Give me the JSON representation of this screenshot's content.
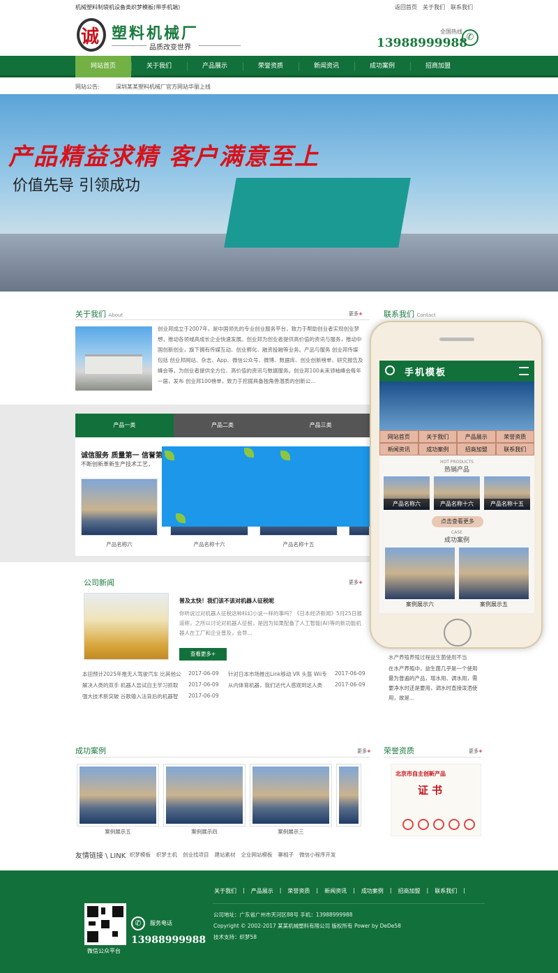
{
  "topbar": {
    "site_desc": "机械塑料制袋机设备类织梦模板(带手机端)",
    "links": [
      "返回首页",
      "关于我们",
      "联系我们"
    ]
  },
  "header": {
    "logo_char": "诚",
    "logo_title": "塑料机械厂",
    "logo_slogan": "品质改变世界",
    "hotline_label": "全国热线",
    "hotline": "13988999988"
  },
  "nav": {
    "items": [
      "网站首页",
      "关于我们",
      "产品展示",
      "荣誉资质",
      "新闻资讯",
      "成功案例",
      "招商加盟"
    ]
  },
  "notice": {
    "label": "网站公告:",
    "text": "深圳某某塑料机械厂官方网站华丽上线"
  },
  "banner": {
    "headline": "产品精益求精  客户满意至上",
    "subline": "价值先导 引领成功"
  },
  "about": {
    "title": "关于我们",
    "title_en": "About",
    "more": "更多",
    "text": "创业邦成立于2007年，是中国领先的专业创业服务平台，致力于帮助创业者实现创业梦想，推动各领域高成长企业快速发展。创业邦为创业者提供高价值的资讯与服务，推动中国创新创业，旗下拥有传媒互动、创业孵化、融资投融等业务。产品与服务 创业邦传媒 包括 创业邦网站、杂志、App、微信公众号、微博、数据库、创业创新榜单、研究报告及峰会等，为创业者提供全方位、高价值的资讯与数据服务。创业邦100未来领袖峰会每年一届，发布 创业邦100榜单，致力于挖掘具备独角兽潜质的创新公..."
  },
  "contact": {
    "title": "联系我们",
    "title_en": "Contact"
  },
  "products": {
    "tabs": [
      "产品一类",
      "产品二类",
      "产品三类"
    ],
    "slogan": "诚信服务 质量第一 信誉第",
    "slogan2": "不断创新革新生产技术工艺，",
    "items": [
      "产品名称六",
      "产品名称十六",
      "产品名称十五"
    ]
  },
  "news": {
    "title": "公司新闻",
    "more": "更多",
    "headline": "普及太快！我们该不该对机器人征税呢",
    "desc": "你听说过对机器人征税这种科幻小说一样的事吗？《日本经济新闻》5月25日报道称，之所以讨论对机器人征税，是因为如果配备了人工智能(AI)等的新功能机器人在工厂和企业普及，会导...",
    "btn": "查看更多+",
    "list_left": [
      {
        "title": "本田预计2025年推无人驾驶汽车 比其他公",
        "date": "2017-06-09"
      },
      {
        "title": "解决人类的双手 机器人尝试自主学习抓取",
        "date": "2017-06-09"
      },
      {
        "title": "强大技术新突破 谷歌输入法背后的机器智",
        "date": "2017-06-09"
      }
    ],
    "list_right": [
      {
        "title": "针对日本市场推出Link移动 VR 头盔 Wii专",
        "date": "2017-06-09"
      },
      {
        "title": "从内体育机器，我们达代人感观到这人类",
        "date": "2017-06-09"
      }
    ]
  },
  "side_news": {
    "title": "水产养殖养殖过程益生菌使用不当",
    "text": "在水产养殖中，益生菌几乎是一个使用最为普遍的产品，增水用、调水用，需要净水时还是要用，调水时直接泼洒使用，故是..."
  },
  "phone": {
    "title": "手机模板",
    "nav": [
      "网站首页",
      "关于我们",
      "产品展示",
      "荣誉资质",
      "新闻资讯",
      "成功案例",
      "招商加盟",
      "联系我们"
    ],
    "hot_en": "HOT PRODUCTS",
    "hot": "热销产品",
    "hot_items": [
      "产品名称六",
      "产品名称十六",
      "产品名称十五"
    ],
    "btn": "点击查看更多",
    "case_en": "CASE",
    "case": "成功案例",
    "cases": [
      "案例展示六",
      "案例展示五"
    ]
  },
  "cases": {
    "title": "成功案例",
    "more": "更多",
    "items": [
      "案例展示五",
      "案例展示四",
      "案例展示三"
    ]
  },
  "honor": {
    "title": "荣誉资质",
    "more": "更多",
    "cert_line1": "北京市自主创新产品",
    "cert_line2": "证书"
  },
  "links": {
    "label": "友情链接 \\ LINK",
    "items": [
      "织梦模板",
      "织梦主机",
      "创业找项目",
      "建站素材",
      "企业网站模板",
      "寨相子",
      "微信小程序开发"
    ]
  },
  "footer": {
    "nav": [
      "关于我们",
      "产品展示",
      "荣誉资质",
      "新闻资讯",
      "成功案例",
      "招商加盟",
      "联系我们"
    ],
    "qr_label": "微信公众平台",
    "tel_label": "服务电话",
    "tel": "13988999988",
    "address": "公司地址：广东省广州市天河区88号 手机：13988999988",
    "copyright": "Copyright © 2002-2017 某某机械塑料有限公司 版权所有 Power by DeDe58",
    "support": "技术支持：织梦58"
  },
  "colors": {
    "brand": "#12703a",
    "accent": "#73b144",
    "red": "#c9121c"
  }
}
